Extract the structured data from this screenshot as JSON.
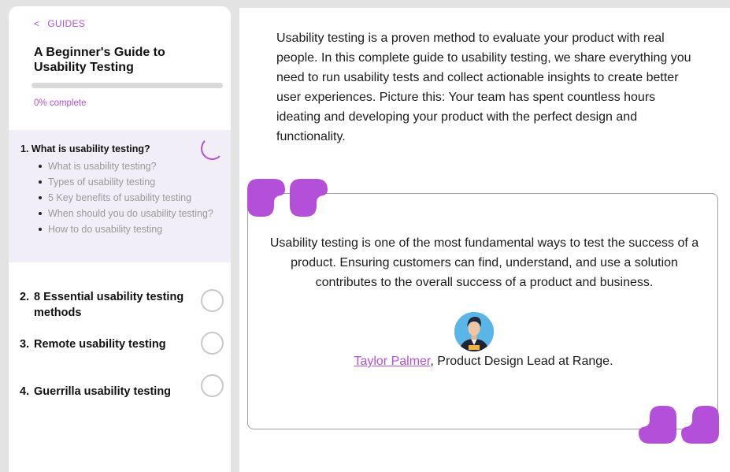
{
  "sidebar": {
    "back_arrow": "<",
    "back_label": "GUIDES",
    "title": "A Beginner's Guide to Usability Testing",
    "progress_percent": 0,
    "progress_label": "0% complete",
    "sections": [
      {
        "number": "1.",
        "title": "What is usability testing?",
        "active": true,
        "subitems": [
          "What is usability testing?",
          "Types of usability testing",
          "5 Key benefits of usability testing",
          "When should you do usability testing?",
          "How to do usability testing"
        ]
      },
      {
        "number": "2.",
        "title": "8 Essential usability testing methods"
      },
      {
        "number": "3.",
        "title": "Remote usability testing"
      },
      {
        "number": "4.",
        "title": "Guerrilla usability testing"
      }
    ]
  },
  "main": {
    "intro": "Usability testing is a proven method to evaluate your product with real people. In this complete guide to usability testing, we share everything you need to run usability tests and collect actionable insights to create better user experiences. Picture this: Your team has spent countless hours ideating and developing your product with the perfect design and functionality.",
    "quote": {
      "text": "Usability testing is one of the most fundamental ways to test the success of a product. Ensuring customers can find, understand, and use a solution contributes to the overall success of a product and business.",
      "author": "Taylor Palmer",
      "role": ", Product Design Lead at Range."
    }
  },
  "colors": {
    "accent": "#b34fd8",
    "active_section_bg": "#f1eef8",
    "page_bg": "#e3e3e3"
  },
  "icons": [
    "back-chevron-icon",
    "progress-spinner-icon",
    "status-circle-icon",
    "open-quote-icon",
    "close-quote-icon",
    "avatar"
  ]
}
